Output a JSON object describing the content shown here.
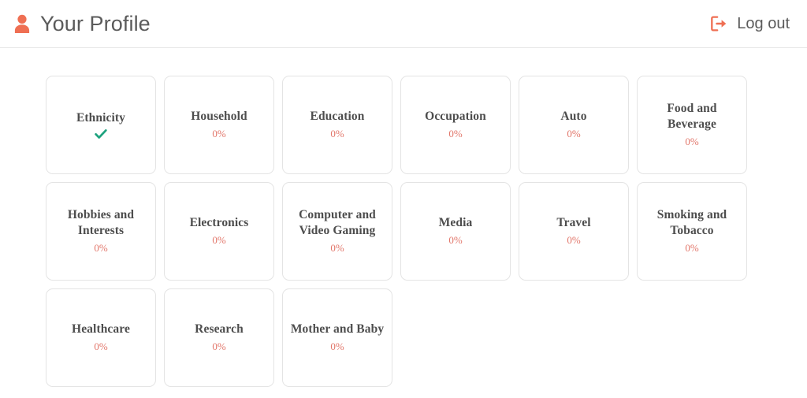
{
  "header": {
    "title": "Your Profile",
    "user_icon": "user-icon",
    "logout_label": "Log out",
    "logout_icon": "logout-icon",
    "accent_color": "#ef6f53",
    "title_color": "#5b5b5b",
    "divider_color": "#e7e7e7"
  },
  "theme": {
    "background": "#ffffff",
    "card_border": "#e4e4e4",
    "card_title_color": "#4d4d4d",
    "percent_color": "#e2766a",
    "check_color": "#1fa37f"
  },
  "cards": [
    {
      "title": "Ethnicity",
      "status": "check",
      "percent": "",
      "check_icon": "check-icon"
    },
    {
      "title": "Household",
      "status": "percent",
      "percent": "0%"
    },
    {
      "title": "Education",
      "status": "percent",
      "percent": "0%"
    },
    {
      "title": "Occupation",
      "status": "percent",
      "percent": "0%"
    },
    {
      "title": "Auto",
      "status": "percent",
      "percent": "0%"
    },
    {
      "title": "Food and Beverage",
      "status": "percent",
      "percent": "0%"
    },
    {
      "title": "Hobbies and Interests",
      "status": "percent",
      "percent": "0%"
    },
    {
      "title": "Electronics",
      "status": "percent",
      "percent": "0%"
    },
    {
      "title": "Computer and Video Gaming",
      "status": "percent",
      "percent": "0%"
    },
    {
      "title": "Media",
      "status": "percent",
      "percent": "0%"
    },
    {
      "title": "Travel",
      "status": "percent",
      "percent": "0%"
    },
    {
      "title": "Smoking and Tobacco",
      "status": "percent",
      "percent": "0%"
    },
    {
      "title": "Healthcare",
      "status": "percent",
      "percent": "0%"
    },
    {
      "title": "Research",
      "status": "percent",
      "percent": "0%"
    },
    {
      "title": "Mother and Baby",
      "status": "percent",
      "percent": "0%"
    }
  ]
}
